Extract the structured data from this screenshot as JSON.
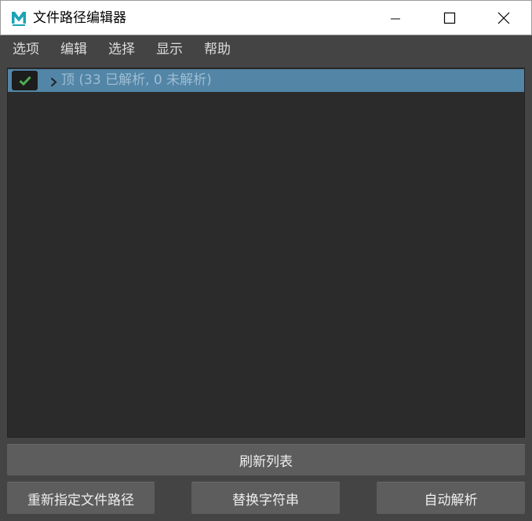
{
  "window": {
    "title": "文件路径编辑器",
    "logo_letter": "M"
  },
  "menu": {
    "items": [
      "选项",
      "编辑",
      "选择",
      "显示",
      "帮助"
    ]
  },
  "tree": {
    "root_label": "顶 (33 已解析, 0 未解析)",
    "root_checked": true
  },
  "buttons": {
    "refresh": "刷新列表",
    "remap": "重新指定文件路径",
    "replace": "替换字符串",
    "auto_resolve": "自动解析"
  },
  "colors": {
    "accent": "#5285a6",
    "check": "#4caf50",
    "background": "#444444",
    "panel": "#2b2b2b"
  }
}
